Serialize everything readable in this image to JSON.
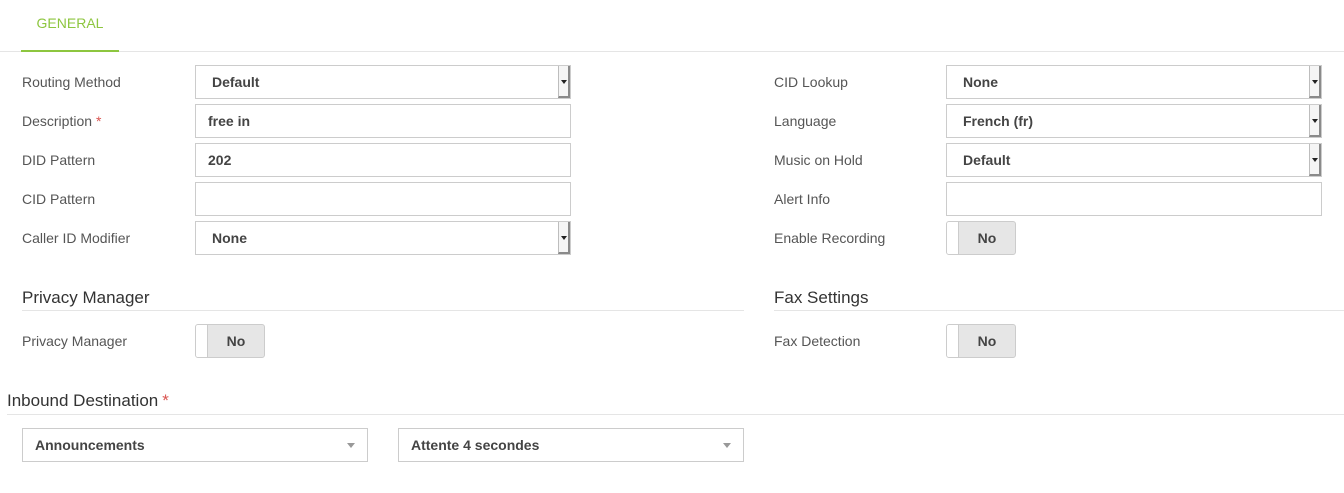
{
  "tabs": [
    {
      "label": "GENERAL",
      "active": true
    }
  ],
  "general": {
    "routing_method": {
      "label": "Routing Method",
      "value": "Default"
    },
    "description": {
      "label": "Description",
      "required_mark": "*",
      "value": "free in"
    },
    "did_pattern": {
      "label": "DID Pattern",
      "value": "202"
    },
    "cid_pattern": {
      "label": "CID Pattern",
      "value": ""
    },
    "caller_id_modifier": {
      "label": "Caller ID Modifier",
      "value": "None"
    },
    "cid_lookup": {
      "label": "CID Lookup",
      "value": "None"
    },
    "language": {
      "label": "Language",
      "value": "French (fr)"
    },
    "music_on_hold": {
      "label": "Music on Hold",
      "value": "Default"
    },
    "alert_info": {
      "label": "Alert Info",
      "value": ""
    },
    "enable_recording": {
      "label": "Enable Recording",
      "value": "No"
    }
  },
  "privacy": {
    "title": "Privacy Manager",
    "privacy_manager": {
      "label": "Privacy Manager",
      "value": "No"
    }
  },
  "fax": {
    "title": "Fax Settings",
    "fax_detection": {
      "label": "Fax Detection",
      "value": "No"
    }
  },
  "destination": {
    "title": "Inbound Destination",
    "required_mark": "*",
    "type": "Announcements",
    "target": "Attente 4 secondes"
  },
  "colors": {
    "accent": "#8dc63f",
    "required": "#d9534f"
  }
}
